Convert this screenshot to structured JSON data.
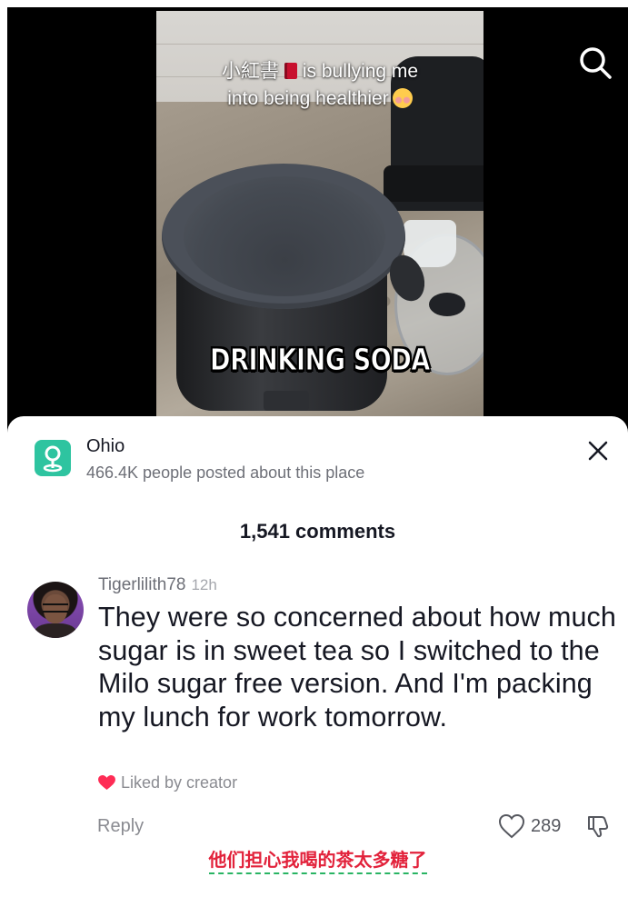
{
  "video": {
    "caption_line1_prefix": "小紅書",
    "caption_line1_suffix": "is bullying me",
    "caption_line2": "into being healthier",
    "overlay_text": "DRINKING SODA",
    "search_icon": "search-icon"
  },
  "place": {
    "name": "Ohio",
    "subtitle": "466.4K people posted about this place",
    "icon": "map-pin-icon",
    "accent_color": "#2ec4a0"
  },
  "comments_header": {
    "count_label": "1,541 comments"
  },
  "comment": {
    "username": "Tigerlilith78",
    "time": "12h",
    "text": "They were so concerned about how much sugar is in sweet tea so I switched to the Milo sugar free version. And I'm packing my lunch for work tomorrow.",
    "liked_by_creator": "Liked by creator",
    "reply_label": "Reply",
    "like_count": "289"
  },
  "translation": {
    "text": "他们担心我喝的茶太多糖了",
    "color": "#e2223b"
  }
}
